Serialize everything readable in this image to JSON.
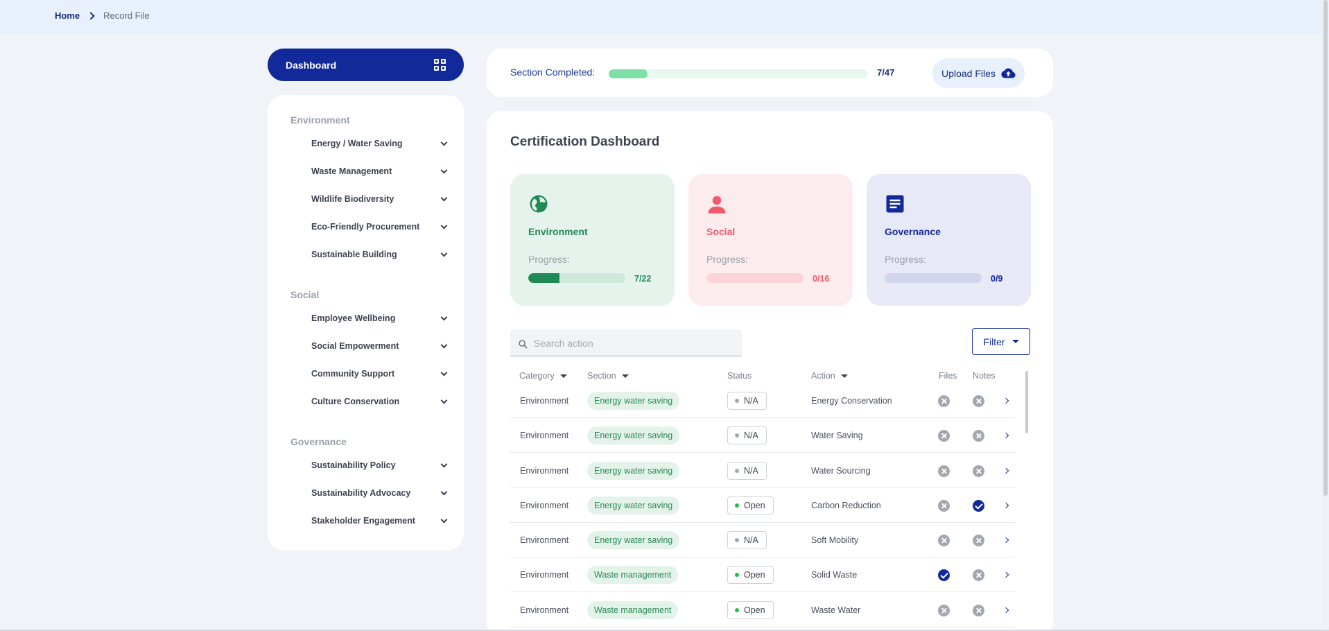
{
  "breadcrumb": {
    "home": "Home",
    "current": "Record File"
  },
  "sidebar": {
    "dashboard_label": "Dashboard",
    "groups": [
      {
        "title": "Environment",
        "items": [
          "Energy / Water Saving",
          "Waste Management",
          "Wildlife Biodiversity",
          "Eco-Friendly Procurement",
          "Sustainable Building"
        ]
      },
      {
        "title": "Social",
        "items": [
          "Employee Wellbeing",
          "Social Empowerment",
          "Community Support",
          "Culture Conservation"
        ]
      },
      {
        "title": "Governance",
        "items": [
          "Sustainability Policy",
          "Sustainability Advocacy",
          "Stakeholder Engagement"
        ]
      }
    ]
  },
  "progress": {
    "label": "Section Completed:",
    "count": "7/47",
    "fraction": 0.149,
    "upload_label": "Upload Files"
  },
  "main": {
    "title": "Certification Dashboard",
    "categories": [
      {
        "name": "Environment",
        "progress_label": "Progress:",
        "count": "7/22",
        "fraction": 0.318,
        "color": "#1f8a55",
        "bg": "#e6f3ec",
        "track": "#cfe8da",
        "icon": "globe-icon"
      },
      {
        "name": "Social",
        "progress_label": "Progress:",
        "count": "0/16",
        "fraction": 0,
        "color": "#f05a6a",
        "bg": "#fdecee",
        "track": "#fbd3d8",
        "icon": "person-icon"
      },
      {
        "name": "Governance",
        "progress_label": "Progress:",
        "count": "0/9",
        "fraction": 0,
        "color": "#12299a",
        "bg": "#e7e9f6",
        "track": "#d0d5ec",
        "icon": "document-icon"
      }
    ],
    "search_placeholder": "Search action",
    "filter_label": "Filter"
  },
  "table": {
    "headers": {
      "category": "Category",
      "section": "Section",
      "status": "Status",
      "action": "Action",
      "files": "Files",
      "notes": "Notes"
    },
    "rows": [
      {
        "category": "Environment",
        "section": "Energy water saving",
        "status": "N/A",
        "action": "Energy Conservation",
        "files": false,
        "notes": false
      },
      {
        "category": "Environment",
        "section": "Energy water saving",
        "status": "N/A",
        "action": "Water Saving",
        "files": false,
        "notes": false
      },
      {
        "category": "Environment",
        "section": "Energy water saving",
        "status": "N/A",
        "action": "Water Sourcing",
        "files": false,
        "notes": false
      },
      {
        "category": "Environment",
        "section": "Energy water saving",
        "status": "Open",
        "action": "Carbon Reduction",
        "files": false,
        "notes": true
      },
      {
        "category": "Environment",
        "section": "Energy water saving",
        "status": "N/A",
        "action": "Soft Mobility",
        "files": false,
        "notes": false
      },
      {
        "category": "Environment",
        "section": "Waste management",
        "status": "Open",
        "action": "Solid Waste",
        "files": true,
        "notes": false
      },
      {
        "category": "Environment",
        "section": "Waste management",
        "status": "Open",
        "action": "Waste Water",
        "files": false,
        "notes": false
      }
    ]
  }
}
